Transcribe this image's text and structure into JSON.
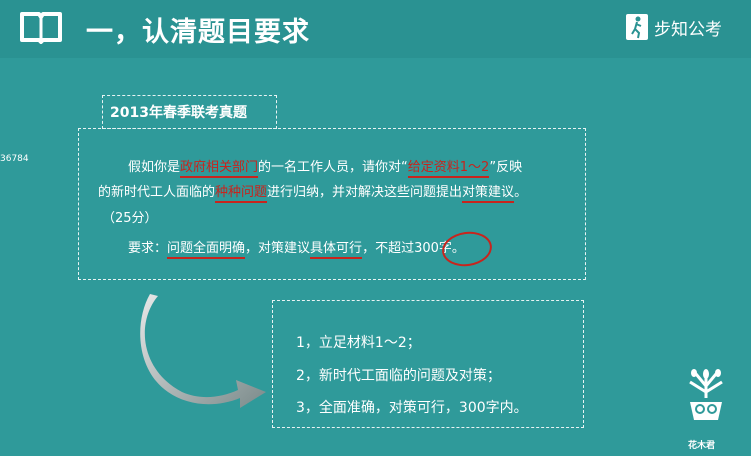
{
  "header": {
    "title": "一，认清题目要求",
    "logo_text": "步知公考"
  },
  "tag": "2013年春季联考真题",
  "side_number": "36784",
  "question": {
    "line1_a": "假如你是",
    "line1_hl1": "政府相关部门",
    "line1_b": "的一名工作人员，请你对“",
    "line1_hl2": "给定资料1～2",
    "line1_c": "”反映",
    "line2_a": "的新时代工人面临的",
    "line2_hl1": "种种问题",
    "line2_b": "进行归纳，并对解决这些问题提出",
    "line2_hl2": "对策建议",
    "line2_c": "。",
    "line3": "（25分）",
    "line4_a": "要求：",
    "line4_hl1": "问题全面明确",
    "line4_b": "，对策建议",
    "line4_hl2": "具体可行",
    "line4_c": "，不超过",
    "line4_d": "300字",
    "line4_e": "。"
  },
  "answers": [
    "1，立足材料1～2；",
    "2，新时代工面临的问题及对策；",
    "3，全面准确，对策可行，300字内。"
  ],
  "mascot_label": "花木君",
  "colors": {
    "background": "#2f9a9a",
    "highlight": "#c8241d",
    "text": "#ffffff"
  }
}
